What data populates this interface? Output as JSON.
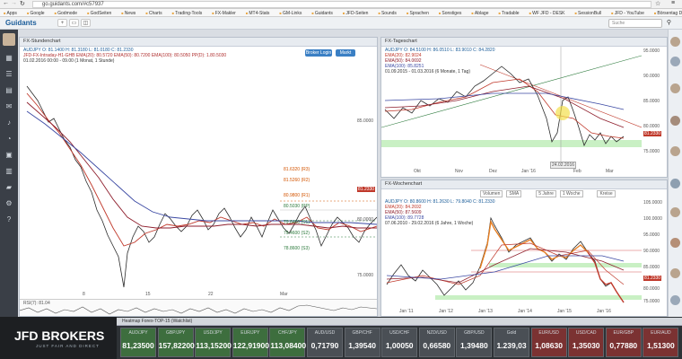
{
  "browser": {
    "url": "go.guidants.com/#c57937",
    "bookmarks": [
      "Apps",
      "Google",
      "Godmode",
      "GodSeiten",
      "News",
      "Charts",
      "Trading-Tools",
      "FX-Makler",
      "MT4-Stats",
      "GM-Links",
      "Guidants",
      "JFD-Seiten",
      "Sounds",
      "Sprachen",
      "Sonstiges",
      "Ablage",
      "Tradable",
      "WF JFD - DESK",
      "SessionBull",
      "JFD - YouTube",
      "Börsentag Dresden ..."
    ]
  },
  "app": {
    "logo": "Guidants",
    "search_placeholder": "Suche"
  },
  "panel_left": {
    "title": "FX-Stundenchart",
    "legend": [
      "AUDJPY  O: 81.1400  H: 81.3180  L: 81.0180  C: 81.2330",
      "JFD-FX-Intraday-H1-GHB  EMA(20): 80.5720  EMA(50): 80.7200  EMA(100): 80.5050  PP(D): 1.80.5030",
      "01.02.2016 00:00 - 09.00 (1 Monat, 1 Stunde)"
    ],
    "broker_button": "Broker Login",
    "market_button": "Markt",
    "levels": [
      "81.6320 (R3)",
      "81.5260 (R2)",
      "80.9800 (R1)",
      "80.5030 (PP)",
      "79.6400 (S1)",
      "79.4600 (S2)",
      "78.8600 (S3)"
    ],
    "price_label": "81.2330",
    "y_ticks": [
      "85.0000",
      "80.0000",
      "75.0000"
    ],
    "x_ticks": [
      "8",
      "15",
      "22",
      "Mar"
    ],
    "rsi_label": "RSI(7): 81.04"
  },
  "panel_top_right": {
    "title": "FX-Tageschart",
    "legend": [
      "AUDJPY  O: 84.5100  H: 86.0510  L: 83.9010  C: 84.2820",
      "EMA(20): 82.9024",
      "EMA(50): 84.0692",
      "EMA(100): 85.8251",
      "01.09.2015 - 01.03.2016 (6 Monate, 1 Tag)"
    ],
    "y_ticks": [
      "95.0000",
      "90.0000",
      "85.0000",
      "80.0000",
      "75.0000"
    ],
    "x_ticks": [
      "Okt",
      "Nov",
      "Dez",
      "Jan '16",
      "Feb",
      "Mar"
    ],
    "price_label": "81.2330",
    "date_label": "24.02.2016"
  },
  "panel_bottom_right": {
    "title": "FX-Wochenchart",
    "legend": [
      "AUDJPY  O: 80.8600  H: 81.2630  L: 79.8040  C: 81.2330",
      "EMA(20): 84.2692",
      "EMA(50): 87.5609",
      "EMA(100): 89.7728",
      "07.06.2010 - 29.02.2016 (6 Jahre, 1 Woche)"
    ],
    "toolbar": [
      "Volumen",
      "SMA",
      "5 Jahre",
      "1 Woche",
      "Kreise"
    ],
    "y_ticks": [
      "105.0000",
      "100.0000",
      "95.0000",
      "90.0000",
      "85.0000",
      "80.0000",
      "75.0000"
    ],
    "x_ticks": [
      "Jan '11",
      "Jan '12",
      "Jan '13",
      "Jan '14",
      "Jan '15",
      "Jan '16"
    ],
    "price_label": "81.2330"
  },
  "ticker": {
    "brand": "JFD BROKERS",
    "brand_sub": "JUST FAIR AND DIRECT",
    "header": "Heatmap  Forex-TOP-15 (Watchlist)",
    "items": [
      {
        "sym": "AUD/JPY",
        "val": "81,23500",
        "dir": "up"
      },
      {
        "sym": "GBP/JPY",
        "val": "157,82200",
        "dir": "up"
      },
      {
        "sym": "USD/JPY",
        "val": "113,15200",
        "dir": "up"
      },
      {
        "sym": "EUR/JPY",
        "val": "122,91900",
        "dir": "up"
      },
      {
        "sym": "CHF/JPY",
        "val": "113,08400",
        "dir": "up"
      },
      {
        "sym": "AUD/USD",
        "val": "0,71790",
        "dir": "flat"
      },
      {
        "sym": "GBP/CHF",
        "val": "1,39540",
        "dir": "flat"
      },
      {
        "sym": "USD/CHF",
        "val": "1,00050",
        "dir": "flat"
      },
      {
        "sym": "NZD/USD",
        "val": "0,66580",
        "dir": "flat"
      },
      {
        "sym": "GBP/USD",
        "val": "1,39480",
        "dir": "flat"
      },
      {
        "sym": "Gold",
        "val": "1.239,03",
        "dir": "flat"
      },
      {
        "sym": "EUR/USD",
        "val": "1,08630",
        "dir": "dn"
      },
      {
        "sym": "USD/CAD",
        "val": "1,35030",
        "dir": "dn"
      },
      {
        "sym": "EUR/GBP",
        "val": "0,77880",
        "dir": "dn"
      },
      {
        "sym": "EUR/AUD",
        "val": "1,51300",
        "dir": "dn"
      }
    ]
  },
  "colors": {
    "sidebar": "#3a3f47",
    "ticker_up": "#3d6e3e",
    "ticker_down": "#7b3232",
    "price_line": "#c0392b",
    "ema20": "#c0392b",
    "ema50": "#8e1e2c",
    "ema100": "#3b49a3"
  },
  "icons": [
    "back-icon",
    "forward-icon",
    "reload-icon",
    "star-icon",
    "menu-icon",
    "chart-icon",
    "user-icon",
    "settings-icon",
    "search-icon"
  ]
}
